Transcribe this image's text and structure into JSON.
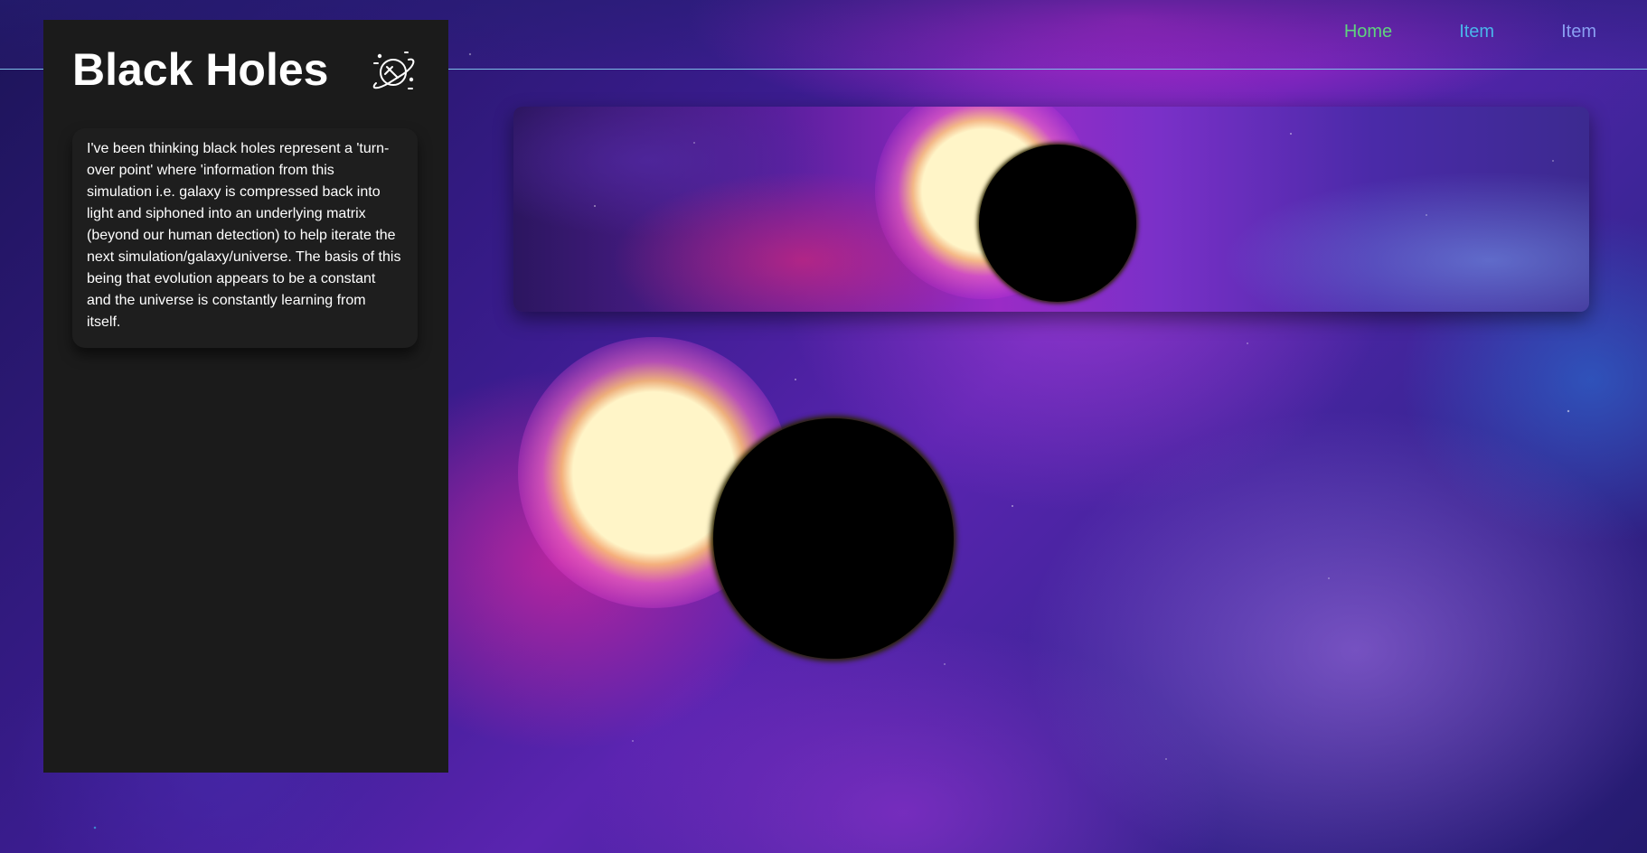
{
  "page": {
    "title": "Black Holes"
  },
  "nav": {
    "items": [
      {
        "label": "Home",
        "color": "#5fd37e"
      },
      {
        "label": "Item",
        "color": "#4ab5ea"
      },
      {
        "label": "Item",
        "color": "#8a9ff2"
      }
    ]
  },
  "sidebar": {
    "title": "Black Holes",
    "icon": "planet-icon",
    "quote": "I've been thinking black holes represent a 'turn-over point' where 'information from this simulation i.e. galaxy is compressed back into light and siphoned into an underlying matrix (beyond our human detection) to help iterate the next simulation/galaxy/universe. The basis of this being that evolution appears to be a constant and the universe is constantly learning from itself."
  },
  "colors": {
    "sidebar_bg": "#1b1b1b",
    "header_line": "#7fbfe8",
    "text": "#ffffff"
  }
}
